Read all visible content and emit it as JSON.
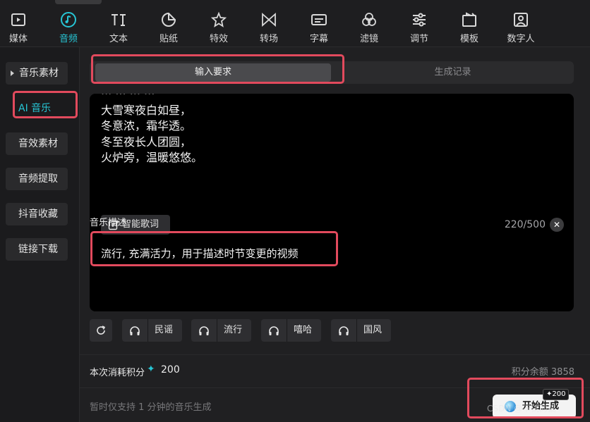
{
  "toolbar": {
    "items": [
      {
        "label": "媒体",
        "icon": "media-icon"
      },
      {
        "label": "音频",
        "icon": "music-note-icon",
        "active": true
      },
      {
        "label": "文本",
        "icon": "text-icon"
      },
      {
        "label": "贴纸",
        "icon": "sticker-icon"
      },
      {
        "label": "特效",
        "icon": "star-effect-icon"
      },
      {
        "label": "转场",
        "icon": "transition-icon"
      },
      {
        "label": "字幕",
        "icon": "subtitle-icon"
      },
      {
        "label": "滤镜",
        "icon": "filter-icon"
      },
      {
        "label": "调节",
        "icon": "adjust-sliders-icon"
      },
      {
        "label": "模板",
        "icon": "template-icon"
      },
      {
        "label": "数字人",
        "icon": "digital-human-icon"
      }
    ]
  },
  "sidebar": {
    "items": [
      {
        "label": "音乐素材"
      },
      {
        "label": "AI 音乐",
        "active": true
      },
      {
        "label": "音效素材"
      },
      {
        "label": "音频提取"
      },
      {
        "label": "抖音收藏"
      },
      {
        "label": "链接下载"
      }
    ]
  },
  "tabs": {
    "input": "输入要求",
    "history": "生成记录"
  },
  "lyrics": {
    "lines": [
      "大雪寒夜白如昼，",
      "冬意浓，霜华透。",
      "冬至夜长人团圆，",
      "火炉旁，温暖悠悠。"
    ],
    "smart_lyrics_label": "智能歌词",
    "char_count": "220/500"
  },
  "description": {
    "label": "音乐描述",
    "text": "流行, 充满活力，用于描述时节变更的视频"
  },
  "styles": [
    "民谣",
    "流行",
    "嘻哈",
    "国风"
  ],
  "cost": {
    "label": "本次消耗积分",
    "value": "200",
    "balance": "积分余额 3858"
  },
  "notice": "暂时仅支持 1 分钟的音乐生成",
  "generate": {
    "label": "开始生成",
    "badge": "✦200"
  },
  "watermark": "CSDN @不试的猫",
  "colors": {
    "accent": "#27c5d4",
    "highlight": "#e24a5d"
  }
}
